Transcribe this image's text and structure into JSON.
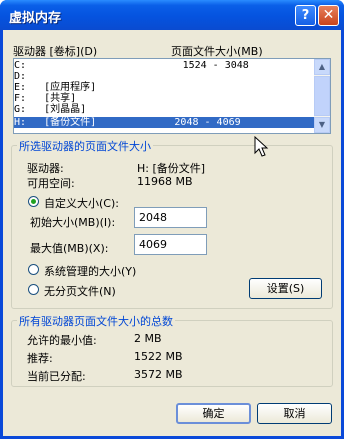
{
  "title": "虚拟内存",
  "title_buttons": {
    "help": "?",
    "close": "✕"
  },
  "drives_header": {
    "drive": "驱动器 [卷标](D)",
    "pagefile": "页面文件大小(MB)"
  },
  "drives": [
    {
      "text": "C:                          1524 - 3048"
    },
    {
      "text": "D:"
    },
    {
      "text": "E:   [应用程序]"
    },
    {
      "text": "F:   [共享]"
    },
    {
      "text": "G:   [刘晶晶]"
    },
    {
      "text": "H:   [备份文件]             2048 - 4069"
    }
  ],
  "selected": {
    "group_label": "所选驱动器的页面文件大小",
    "drive_label": "驱动器:",
    "drive_value": "H:  [备份文件]",
    "free_label": "可用空间:",
    "free_value": "11968 MB",
    "custom_label": "自定义大小(C):",
    "initial_label": "初始大小(MB)(I):",
    "initial_value": "2048",
    "max_label": "最大值(MB)(X):",
    "max_value": "4069",
    "system_label": "系统管理的大小(Y)",
    "nopaging_label": "无分页文件(N)",
    "set_label": "设置(S)"
  },
  "total": {
    "group_label": "所有驱动器页面文件大小的总数",
    "min_label": "允许的最小值:",
    "min_value": "2 MB",
    "rec_label": "推荐:",
    "rec_value": "1522 MB",
    "cur_label": "当前已分配:",
    "cur_value": "3572 MB"
  },
  "buttons": {
    "ok": "确定",
    "cancel": "取消"
  }
}
